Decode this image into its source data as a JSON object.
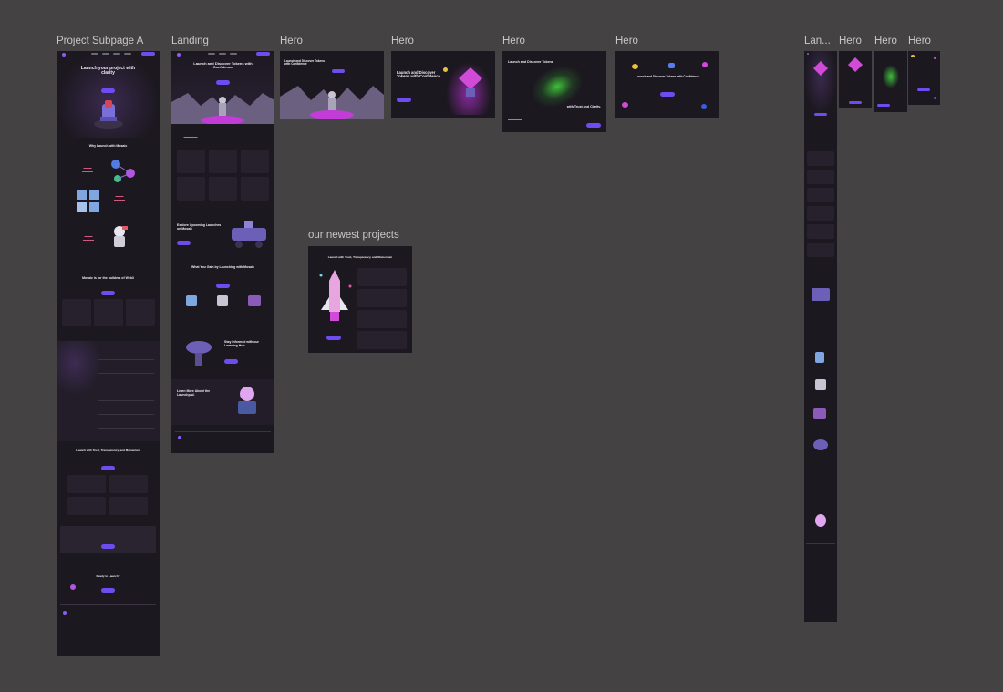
{
  "canvas": {
    "background": "#454244"
  },
  "frames": {
    "project_subpage_a": {
      "label": "Project Subpage A",
      "hero_title": "Launch your project with clarity",
      "why_title": "Why Launch with Mosaic",
      "builders_title": "Mosaic is for the builders of Web3",
      "launch_title": "Launch with Trust, Transparency, and Momentum",
      "ready_title": "Ready to Launch?"
    },
    "landing": {
      "label": "Landing",
      "hero_title": "Launch and Discover Tokens with Confidence",
      "explore_title": "Explore Upcoming Launches on Mosaic",
      "solving_title": "What You Gain by Launching with Mosaic",
      "informed_title": "Stay Informed with our Learning Hub",
      "learn_title": "Learn More About the Launchpad."
    },
    "hero_1": {
      "label": "Hero",
      "title": "Launch and Discover Tokens with Confidence"
    },
    "hero_2": {
      "label": "Hero",
      "title": "Launch and Discover Tokens with Confidence"
    },
    "hero_3": {
      "label": "Hero",
      "title": "Launch and Discover Tokens",
      "subtitle": "with Trust and Clarity."
    },
    "hero_4": {
      "label": "Hero",
      "title": "Launch and Discover Tokens with Confidence"
    },
    "newest": {
      "label": "our newest projects",
      "title": "Launch with Trust, Transparency, and Momentum"
    },
    "mobile": {
      "label": "Lan..."
    },
    "mobile_hero_1": {
      "label": "Hero"
    },
    "mobile_hero_2": {
      "label": "Hero"
    },
    "mobile_hero_3": {
      "label": "Hero"
    }
  },
  "colors": {
    "frame_bg": "#1c1820",
    "accent": "#6d4cf0",
    "pink": "#d24bd8",
    "green": "#3fbf3a"
  }
}
